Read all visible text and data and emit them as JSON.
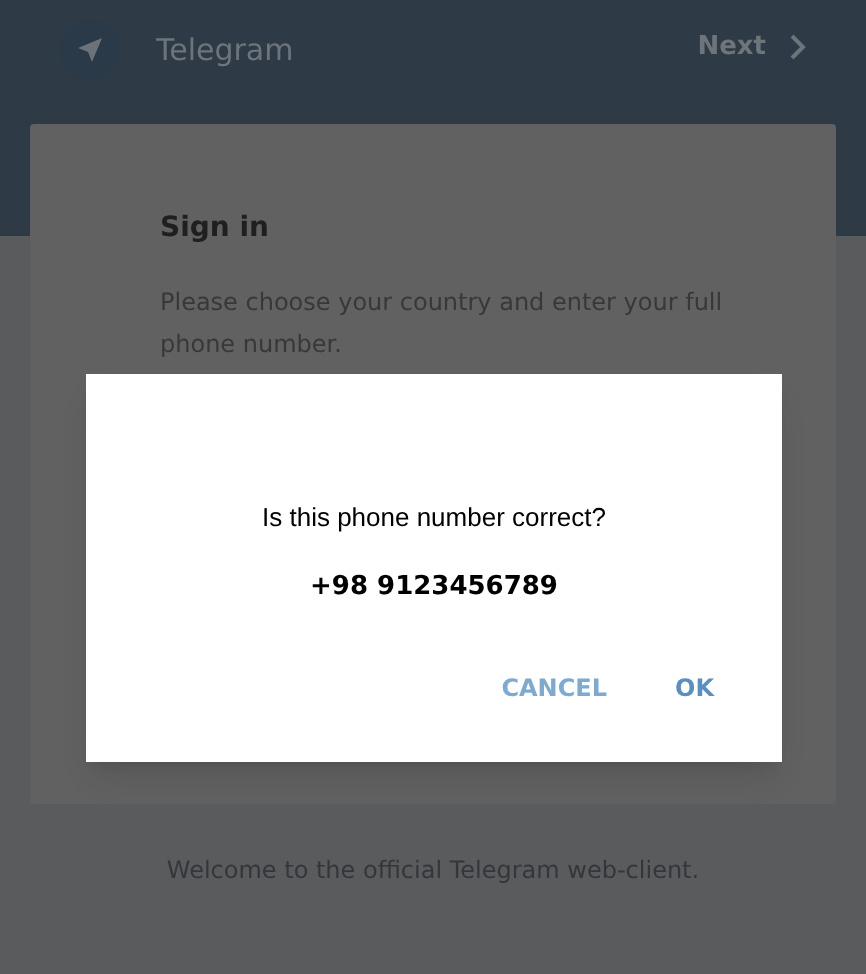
{
  "header": {
    "title": "Telegram",
    "next_button": "Next"
  },
  "card": {
    "title": "Sign in",
    "description": "Please choose your country and enter your full phone number."
  },
  "dialog": {
    "question": "Is this phone number correct?",
    "phone": "+98 9123456789",
    "buttons": [
      "CANCEL",
      "OK"
    ]
  },
  "footer": {
    "welcome": "Welcome to the official Telegram web-client."
  }
}
